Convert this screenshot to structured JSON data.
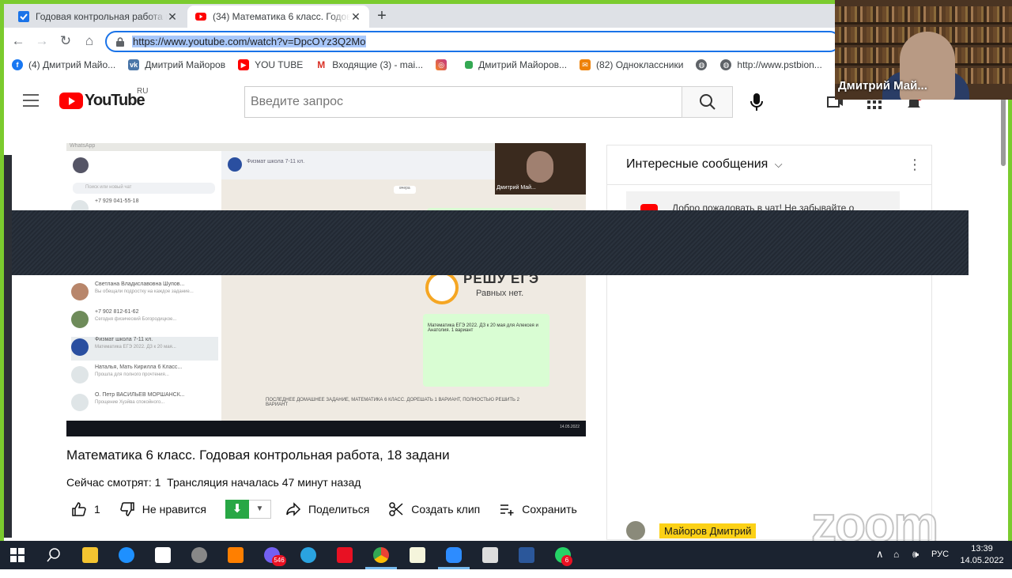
{
  "browser": {
    "tabs": [
      {
        "title": "Годовая контрольная работа по",
        "active": false
      },
      {
        "title": "(34) Математика 6 класс. Годов",
        "active": true
      }
    ],
    "url": "https://www.youtube.com/watch?v=DpcOYz3Q2Mo",
    "bookmarks": [
      {
        "label": "(4) Дмитрий Майо...",
        "icon": "facebook-icon",
        "color": "#1877f2"
      },
      {
        "label": "Дмитрий Майоров",
        "icon": "vk-icon",
        "color": "#4a76a8"
      },
      {
        "label": "YOU TUBE",
        "icon": "youtube-icon",
        "color": "#ff0000"
      },
      {
        "label": "Входящие (3) - mai...",
        "icon": "gmail-icon",
        "color": "#d93025"
      },
      {
        "label": "",
        "icon": "instagram-icon",
        "color": "#c13584"
      },
      {
        "label": "Дмитрий Майоров...",
        "icon": "green-square-icon",
        "color": "#34a853"
      },
      {
        "label": "(82) Одноклассники",
        "icon": "odnoklassniki-icon",
        "color": "#ee8208"
      },
      {
        "label": "",
        "icon": "globe-icon",
        "color": "#5f6368"
      },
      {
        "label": "http://www.pstbion...",
        "icon": "globe-icon",
        "color": "#5f6368"
      },
      {
        "label": "",
        "icon": "google-icon",
        "color": "#ea4335"
      }
    ]
  },
  "youtube": {
    "logo_text": "YouTube",
    "region": "RU",
    "search_placeholder": "Введите запрос"
  },
  "video": {
    "title": "Математика 6 класс. Годовая контрольная работа, 18 задани",
    "watching": "Сейчас смотрят: 1",
    "started": "Трансляция началась 47 минут назад",
    "like_count": "1",
    "dislike_label": "Не нравится",
    "share_label": "Поделиться",
    "clip_label": "Создать клип",
    "save_label": "Сохранить"
  },
  "player_content": {
    "app_label": "WhatsApp",
    "chat_name": "Физмат школа 7-11 кл.",
    "contact_phone_1": "+7 929 041-55-18",
    "contact_1": "Светлана Владиславовна Шупов...",
    "contact_phone_2": "+7 902 812-61-62",
    "contact_3": "Физмат школа 7-11 кл.",
    "contact_4": "Наталья, Мать Кирилла 6 Класс...",
    "contact_5": "О. Петр ВАСИЛЬЕВ МОРШАНСК...",
    "logo_line1": "РЕШУ ЕГЭ",
    "logo_line2": "Равных нет.",
    "mini_cam_name": "Дмитрий Май...",
    "input_text": "ПОСЛЕДНЕЕ ДОМАШНЕЕ ЗАДАНИЕ, МАТЕМАТИКА 6 КЛАСС. ДОРЕШАТЬ 1 ВАРИАНТ, ПОЛНОСТЬЮ РЕШИТЬ 2 ВАРИАНТ",
    "mini_date": "14.05.2022"
  },
  "chat": {
    "title": "Интересные сообщения",
    "welcome": "Добро пожаловать в чат! Не забывайте о",
    "last_author": "Майоров Дмитрий"
  },
  "webcam": {
    "name": "Дмитрий Май..."
  },
  "watermark": "zoom",
  "taskbar": {
    "language": "РУС",
    "time": "13:39",
    "date": "14.05.2022",
    "viber_badge": "546",
    "whatsapp_badge": "6"
  }
}
